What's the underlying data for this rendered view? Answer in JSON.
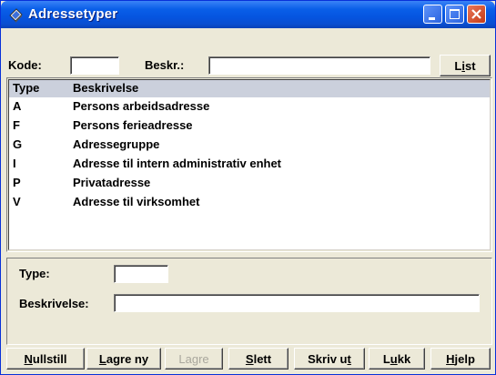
{
  "window": {
    "title": "Adressetyper",
    "icon": "book-icon"
  },
  "filter": {
    "kode_label": "Kode:",
    "kode_value": "",
    "beskr_label": "Beskr.:",
    "beskr_value": "",
    "list_label": [
      "L",
      "i",
      "st"
    ]
  },
  "list": {
    "headers": [
      "Type",
      "Beskrivelse"
    ],
    "rows": [
      {
        "type": "A",
        "desc": "Persons arbeidsadresse"
      },
      {
        "type": "F",
        "desc": "Persons ferieadresse"
      },
      {
        "type": "G",
        "desc": "Adressegruppe"
      },
      {
        "type": "I",
        "desc": "Adresse til intern administrativ enhet"
      },
      {
        "type": "P",
        "desc": "Privatadresse"
      },
      {
        "type": "V",
        "desc": "Adresse til virksomhet"
      }
    ]
  },
  "detail": {
    "type_label": "Type:",
    "type_value": "",
    "beskrivelse_label": "Beskrivelse:",
    "beskrivelse_value": ""
  },
  "buttons": {
    "nullstill": [
      "N",
      "ullstill"
    ],
    "lagre_ny": [
      "L",
      "agre ny"
    ],
    "lagre": "Lagre",
    "slett": [
      "S",
      "lett"
    ],
    "skriv_ut": [
      "Skriv u",
      "t"
    ],
    "lukk": [
      "L",
      "u",
      "kk"
    ],
    "hjelp": [
      "H",
      "jelp"
    ]
  }
}
